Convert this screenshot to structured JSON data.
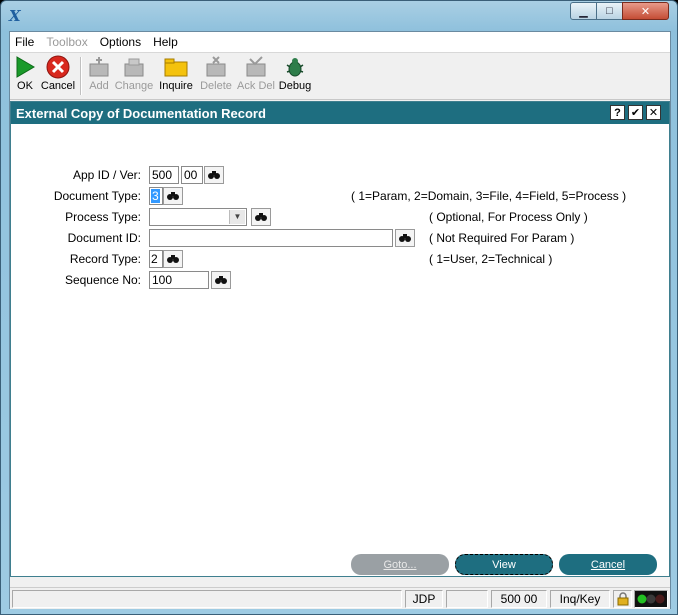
{
  "window": {
    "app_glyph": "X"
  },
  "menu": [
    "File",
    "Toolbox",
    "Options",
    "Help"
  ],
  "toolbar": {
    "ok": "OK",
    "cancel": "Cancel",
    "add": "Add",
    "change": "Change",
    "inquire": "Inquire",
    "delete": "Delete",
    "ack_del": "Ack Del",
    "debug": "Debug"
  },
  "panel": {
    "title": "External Copy of Documentation Record",
    "help_glyph": "?",
    "ok_glyph": "✔",
    "close_glyph": "✕"
  },
  "form": {
    "app_id_label": "App ID / Ver:",
    "app_id_value": "500",
    "ver_value": "00",
    "doc_type_label": "Document Type:",
    "doc_type_value": "3",
    "doc_type_hint": "( 1=Param, 2=Domain, 3=File, 4=Field, 5=Process )",
    "process_type_label": "Process Type:",
    "process_type_value": "",
    "process_type_hint": "( Optional, For Process Only )",
    "doc_id_label": "Document ID:",
    "doc_id_value": "",
    "doc_id_hint": "( Not Required For Param )",
    "record_type_label": "Record Type:",
    "record_type_value": "2",
    "record_type_hint": "( 1=User, 2=Technical )",
    "seq_label": "Sequence No:",
    "seq_value": "100"
  },
  "buttons": {
    "goto": "Goto...",
    "view": "View",
    "cancel": "Cancel"
  },
  "status": {
    "user": "JDP",
    "app": "500 00",
    "mode": "Inq/Key"
  },
  "colors": {
    "accent": "#1e6e80",
    "ok_green": "#1a9a2a",
    "cancel_red": "#d8281e"
  }
}
